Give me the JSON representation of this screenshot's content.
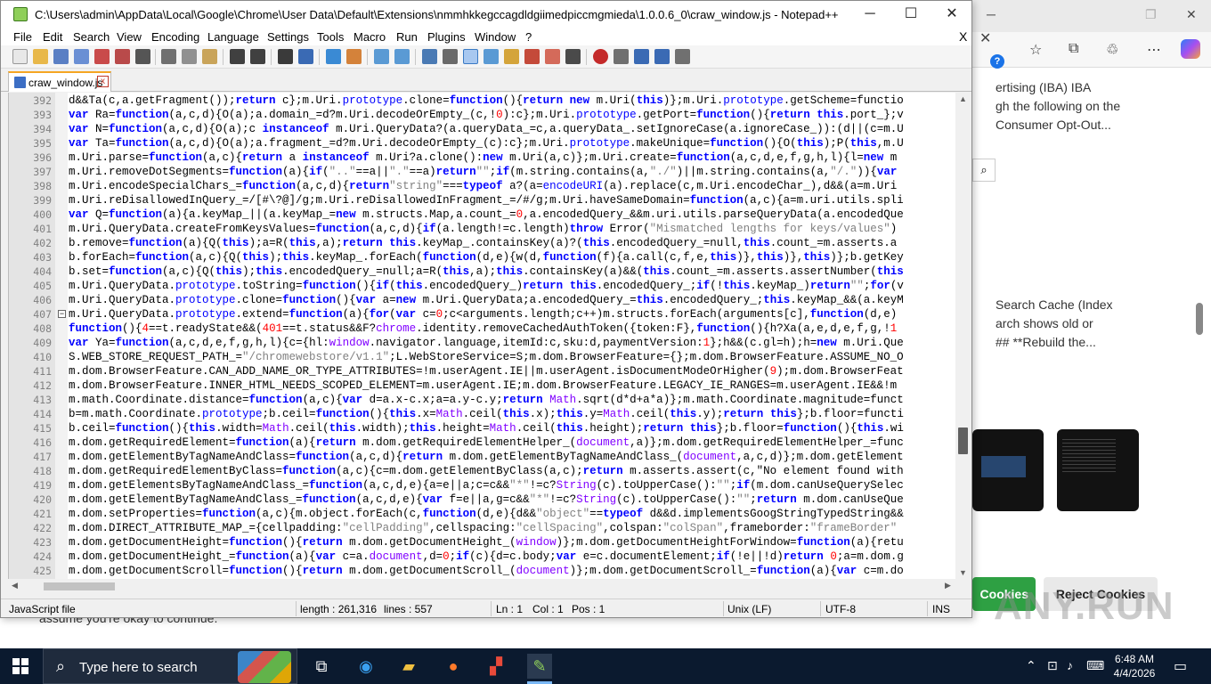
{
  "window": {
    "title": "C:\\Users\\admin\\AppData\\Local\\Google\\Chrome\\User Data\\Default\\Extensions\\nmmhkkegccagdldgiimedpiccmgmieda\\1.0.0.6_0\\craw_window.js - Notepad++",
    "minimize": "─",
    "maximize": "☐",
    "close": "✕"
  },
  "menu": [
    "File",
    "Edit",
    "Search",
    "View",
    "Encoding",
    "Language",
    "Settings",
    "Tools",
    "Macro",
    "Run",
    "Plugins",
    "Window",
    "?"
  ],
  "menu_close": "X",
  "tab": {
    "label": "craw_window.js",
    "close": "x"
  },
  "editor": {
    "lines": [
      {
        "n": "392",
        "code": "d&&Ta(c,a.getFragment());return c};m.Uri.prototype.clone=function(){return new m.Uri(this)};m.Uri.prototype.getScheme=functio"
      },
      {
        "n": "393",
        "code": "var Ra=function(a,c,d){O(a);a.domain_=d?m.Uri.decodeOrEmpty_(c,!0):c};m.Uri.prototype.getPort=function(){return this.port_};v"
      },
      {
        "n": "394",
        "code": "var N=function(a,c,d){O(a);c instanceof m.Uri.QueryData?(a.queryData_=c,a.queryData_.setIgnoreCase(a.ignoreCase_)):(d||(c=m.U"
      },
      {
        "n": "395",
        "code": "var Ta=function(a,c,d){O(a);a.fragment_=d?m.Uri.decodeOrEmpty_(c):c};m.Uri.prototype.makeUnique=function(){O(this);P(this,m.U"
      },
      {
        "n": "396",
        "code": "m.Uri.parse=function(a,c){return a instanceof m.Uri?a.clone():new m.Uri(a,c)};m.Uri.create=function(a,c,d,e,f,g,h,l){l=new m"
      },
      {
        "n": "397",
        "code": "m.Uri.removeDotSegments=function(a){if(\"..\"==a||\".\"==a)return\"\";if(m.string.contains(a,\"./\")||m.string.contains(a,\"/.\")){var"
      },
      {
        "n": "398",
        "code": "m.Uri.encodeSpecialChars_=function(a,c,d){return\"string\"===typeof a?(a=encodeURI(a).replace(c,m.Uri.encodeChar_),d&&(a=m.Uri"
      },
      {
        "n": "399",
        "code": "m.Uri.reDisallowedInQuery_=/[#\\?@]/g;m.Uri.reDisallowedInFragment_=/#/g;m.Uri.haveSameDomain=function(a,c){a=m.uri.utils.spli"
      },
      {
        "n": "400",
        "code": "var Q=function(a){a.keyMap_||(a.keyMap_=new m.structs.Map,a.count_=0,a.encodedQuery_&&m.uri.utils.parseQueryData(a.encodedQue"
      },
      {
        "n": "401",
        "code": "m.Uri.QueryData.createFromKeysValues=function(a,c,d){if(a.length!=c.length)throw Error(\"Mismatched lengths for keys/values\")"
      },
      {
        "n": "402",
        "code": "b.remove=function(a){Q(this);a=R(this,a);return this.keyMap_.containsKey(a)?(this.encodedQuery_=null,this.count_=m.asserts.a"
      },
      {
        "n": "403",
        "code": "b.forEach=function(a,c){Q(this);this.keyMap_.forEach(function(d,e){w(d,function(f){a.call(c,f,e,this)},this)},this)};b.getKey"
      },
      {
        "n": "404",
        "code": "b.set=function(a,c){Q(this);this.encodedQuery_=null;a=R(this,a);this.containsKey(a)&&(this.count_=m.asserts.assertNumber(this"
      },
      {
        "n": "405",
        "code": "m.Uri.QueryData.prototype.toString=function(){if(this.encodedQuery_)return this.encodedQuery_;if(!this.keyMap_)return\"\";for(v"
      },
      {
        "n": "406",
        "code": "m.Uri.QueryData.prototype.clone=function(){var a=new m.Uri.QueryData;a.encodedQuery_=this.encodedQuery_;this.keyMap_&&(a.keyM"
      },
      {
        "n": "407",
        "code": "m.Uri.QueryData.prototype.extend=function(a){for(var c=0;c<arguments.length;c++)m.structs.forEach(arguments[c],function(d,e)"
      },
      {
        "n": "408",
        "code": "function(){4==t.readyState&&(401==t.status&&F?chrome.identity.removeCachedAuthToken({token:F},function(){h?Xa(a,e,d,e,f,g,!1"
      },
      {
        "n": "409",
        "code": "var Ya=function(a,c,d,e,f,g,h,l){c={hl:window.navigator.language,itemId:c,sku:d,paymentVersion:1};h&&(c.gl=h);h=new m.Uri.Que"
      },
      {
        "n": "410",
        "code": "S.WEB_STORE_REQUEST_PATH_=\"/chromewebstore/v1.1\";L.WebStoreService=S;m.dom.BrowserFeature={};m.dom.BrowserFeature.ASSUME_NO_O"
      },
      {
        "n": "411",
        "code": "m.dom.BrowserFeature.CAN_ADD_NAME_OR_TYPE_ATTRIBUTES=!m.userAgent.IE||m.userAgent.isDocumentModeOrHigher(9);m.dom.BrowserFeat"
      },
      {
        "n": "412",
        "code": "m.dom.BrowserFeature.INNER_HTML_NEEDS_SCOPED_ELEMENT=m.userAgent.IE;m.dom.BrowserFeature.LEGACY_IE_RANGES=m.userAgent.IE&&!m"
      },
      {
        "n": "413",
        "code": "m.math.Coordinate.distance=function(a,c){var d=a.x-c.x;a=a.y-c.y;return Math.sqrt(d*d+a*a)};m.math.Coordinate.magnitude=funct"
      },
      {
        "n": "414",
        "code": "b=m.math.Coordinate.prototype;b.ceil=function(){this.x=Math.ceil(this.x);this.y=Math.ceil(this.y);return this};b.floor=functi"
      },
      {
        "n": "415",
        "code": "b.ceil=function(){this.width=Math.ceil(this.width);this.height=Math.ceil(this.height);return this};b.floor=function(){this.wi"
      },
      {
        "n": "416",
        "code": "m.dom.getRequiredElement=function(a){return m.dom.getRequiredElementHelper_(document,a)};m.dom.getRequiredElementHelper_=func"
      },
      {
        "n": "417",
        "code": "m.dom.getElementByTagNameAndClass=function(a,c,d){return m.dom.getElementByTagNameAndClass_(document,a,c,d)};m.dom.getElement"
      },
      {
        "n": "418",
        "code": "m.dom.getRequiredElementByClass=function(a,c){c=m.dom.getElementByClass(a,c);return m.asserts.assert(c,\"No element found with"
      },
      {
        "n": "419",
        "code": "m.dom.getElementsByTagNameAndClass_=function(a,c,d,e){a=e||a;c=c&&\"*\"!=c?String(c).toUpperCase():\"\";if(m.dom.canUseQuerySelec"
      },
      {
        "n": "420",
        "code": "m.dom.getElementByTagNameAndClass_=function(a,c,d,e){var f=e||a,g=c&&\"*\"!=c?String(c).toUpperCase():\"\";return m.dom.canUseQue"
      },
      {
        "n": "421",
        "code": "m.dom.setProperties=function(a,c){m.object.forEach(c,function(d,e){d&&\"object\"==typeof d&&d.implementsGoogStringTypedString&&"
      },
      {
        "n": "422",
        "code": "m.dom.DIRECT_ATTRIBUTE_MAP_={cellpadding:\"cellPadding\",cellspacing:\"cellSpacing\",colspan:\"colSpan\",frameborder:\"frameBorder\""
      },
      {
        "n": "423",
        "code": "m.dom.getDocumentHeight=function(){return m.dom.getDocumentHeight_(window)};m.dom.getDocumentHeightForWindow=function(a){retu"
      },
      {
        "n": "424",
        "code": "m.dom.getDocumentHeight_=function(a){var c=a.document,d=0;if(c){d=c.body;var e=c.documentElement;if(!e||!d)return 0;a=m.dom.g"
      },
      {
        "n": "425",
        "code": "m.dom.getDocumentScroll=function(){return m.dom.getDocumentScroll_(document)};m.dom.getDocumentScroll_=function(a){var c=m.do"
      }
    ],
    "fold_line": "407"
  },
  "status": {
    "file_type": "JavaScript file",
    "length": "length : 261,316",
    "lines": "lines : 557",
    "ln": "Ln : 1",
    "col": "Col : 1",
    "pos": "Pos : 1",
    "eol": "Unix (LF)",
    "encoding": "UTF-8",
    "mode": "INS"
  },
  "browser": {
    "text1": [
      "ertising (IBA) IBA",
      "gh the following on the",
      "Consumer Opt-Out..."
    ],
    "text2": [
      "Search Cache (Index",
      "arch shows old or",
      "## **Rebuild the..."
    ],
    "accept_label": "Cookies",
    "reject_label": "Reject Cookies",
    "assume_text": "assume you're okay to continue.",
    "watermark": "ANY.RUN",
    "toolbar_icons": [
      "star-icon",
      "collections-icon",
      "extension-icon",
      "more-icon",
      "copilot-icon"
    ]
  },
  "taskbar": {
    "search_placeholder": "Type here to search",
    "time": "6:48 AM",
    "date": "4/4/2026"
  },
  "colors": {
    "keyword": "#0000ff",
    "string": "#808080",
    "number": "#ff0000",
    "object": "#8000ff",
    "taskbar": "#0b1a2f",
    "accept": "#2ea043"
  }
}
